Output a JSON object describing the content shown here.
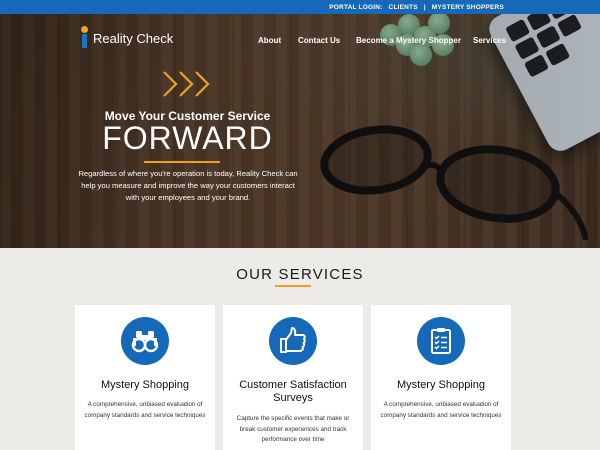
{
  "portal_bar": {
    "label": "PORTAL LOGIN:",
    "links": [
      "CLIENTS",
      "MYSTERY SHOPPERS"
    ],
    "separator": "|"
  },
  "header": {
    "logo_text": "Reality Check",
    "nav": [
      "About",
      "Contact Us",
      "Become a Mystery Shopper",
      "Services"
    ]
  },
  "hero": {
    "tagline": "Move Your Customer Service",
    "headline": "FORWARD",
    "description": "Regardless of where you're operation is today, Reality Check can help you measure and improve the way your customers interact with your employees and your brand."
  },
  "services": {
    "title": "OUR SERVICES",
    "cards": [
      {
        "icon": "binoculars-icon",
        "title": "Mystery Shopping",
        "text": "A comprehensive, unbiased evaluation of company standards and service techniques"
      },
      {
        "icon": "thumbs-up-icon",
        "title": "Customer Satisfaction Surveys",
        "text": "Capture the specific events that make or break customer experiences and track performance over time"
      },
      {
        "icon": "clipboard-checklist-icon",
        "title": "Mystery Shopping",
        "text": "A comprehensive, unbiased evaluation of company standards and service techniques"
      }
    ]
  },
  "colors": {
    "brand_blue": "#1668b8",
    "accent_orange": "#f0a020",
    "section_bg": "#ecebe8"
  }
}
